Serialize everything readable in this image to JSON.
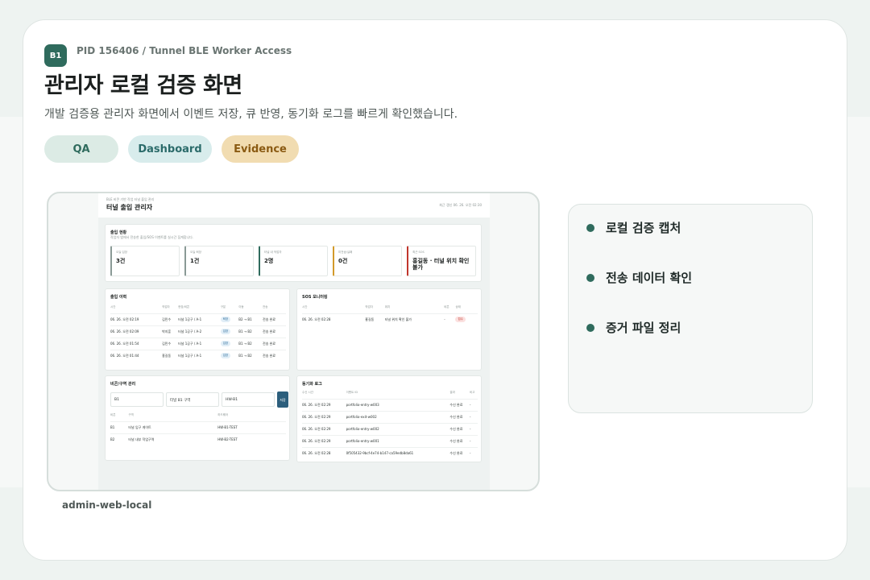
{
  "header": {
    "badge": "B1",
    "pid": "PID 156406 / Tunnel BLE Worker Access",
    "title": "관리자 로컬 검증 화면",
    "subtitle": "개발 검증용 관리자 화면에서 이벤트 저장, 큐 반영, 동기화 로그를 빠르게 확인했습니다."
  },
  "tags": [
    "QA",
    "Dashboard",
    "Evidence"
  ],
  "screenshot": {
    "caption": "admin-web-local",
    "app": {
      "crumb": "BLE 비콘 기반 작업 터널 출입 관리",
      "title": "터널 출입 관리자",
      "updated": "최근 갱신 06. 26. 오전 02:30"
    },
    "overview": {
      "title": "출입 현황",
      "subtitle": "작업자 앱에서 전송한 출입/SOS 이벤트를 실시간 집계합니다.",
      "stats": [
        {
          "label": "오늘 입장",
          "value": "3건",
          "color": "#8a9a96"
        },
        {
          "label": "오늘 퇴장",
          "value": "1건",
          "color": "#8a9a96"
        },
        {
          "label": "터널 내 작업자",
          "value": "2명",
          "color": "#2f6b5d"
        },
        {
          "label": "미전송/실패",
          "value": "0건",
          "color": "#d39a2a"
        },
        {
          "label": "최근 SOS",
          "value": "홍길동 · 터널 위치 확인 불가",
          "color": "#c0362c"
        }
      ]
    },
    "access_log": {
      "title": "출입 이력",
      "columns": [
        "시간",
        "작업자",
        "현장/비콘",
        "구분",
        "이동",
        "전송"
      ],
      "rows": [
        [
          "06. 26. 오전 02:19",
          "김민수",
          "터널 1공구 / A-1",
          "퇴장",
          "B2 → B1",
          "전송 완료"
        ],
        [
          "06. 26. 오전 02:09",
          "박지훈",
          "터널 1공구 / A-2",
          "입장",
          "B1 → B2",
          "전송 완료"
        ],
        [
          "06. 26. 오전 01:54",
          "김민수",
          "터널 1공구 / A-1",
          "입장",
          "B1 → B2",
          "전송 완료"
        ],
        [
          "06. 26. 오전 01:44",
          "홍길동",
          "터널 1공구 / A-1",
          "입장",
          "B1 → B2",
          "전송 완료"
        ]
      ]
    },
    "sos": {
      "title": "SOS 모니터링",
      "columns": [
        "시간",
        "작업자",
        "위치",
        "비콘",
        "상태"
      ],
      "rows": [
        [
          "06. 26. 오전 02:28",
          "홍길동",
          "터널 위치 확인 불가",
          "-",
          "접수"
        ]
      ]
    },
    "beacon": {
      "title": "비콘/구역 관리",
      "fields": [
        "B1",
        "터널 B1 구역",
        "HW-B1"
      ],
      "save_label": "저장",
      "columns": [
        "비콘",
        "구역",
        "하드웨어"
      ],
      "rows": [
        [
          "B1",
          "터널 입구 게이트",
          "HW-B1-TEST"
        ],
        [
          "B2",
          "터널 내부 작업구역",
          "HW-B2-TEST"
        ]
      ]
    },
    "sync": {
      "title": "동기화 로그",
      "columns": [
        "수신 시간",
        "이벤트 ID",
        "결과",
        "비고"
      ],
      "rows": [
        [
          "06. 26. 오전 02:29",
          "portfolio-entry-w003",
          "수신 완료",
          "-"
        ],
        [
          "06. 26. 오전 02:29",
          "portfolio-exit-w002",
          "수신 완료",
          "-"
        ],
        [
          "06. 26. 오전 02:29",
          "portfolio-entry-w002",
          "수신 완료",
          "-"
        ],
        [
          "06. 26. 오전 02:29",
          "portfolio-entry-w001",
          "수신 완료",
          "-"
        ],
        [
          "06. 26. 오전 02:28",
          "0f505432-9bcf-4e74-b147-ca59edb8da61",
          "수신 완료",
          "-"
        ]
      ]
    }
  },
  "checklist": [
    "로컬 검증 캡처",
    "전송 데이터 확인",
    "증거 파일 정리"
  ],
  "colors": {
    "accent": "#2f6b5d",
    "panel": "#f6f8f7"
  }
}
